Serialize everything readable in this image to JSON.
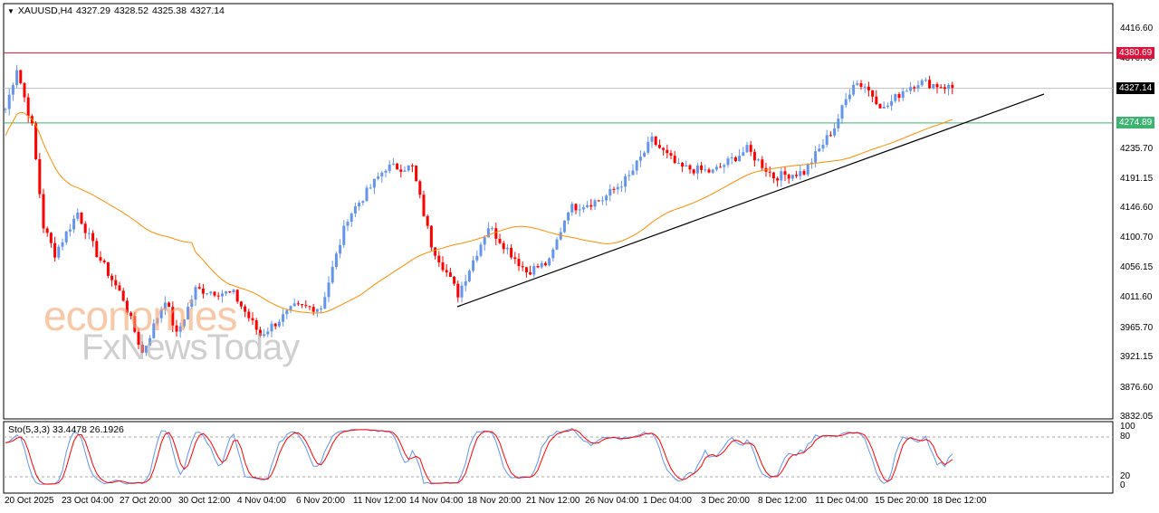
{
  "header": {
    "symbol": "XAUUSD,H4",
    "open": "4327.29",
    "high": "4328.52",
    "low": "4325.38",
    "close": "4327.14"
  },
  "price_axis": [
    "4416.60",
    "4370.70",
    "4235.70",
    "4191.15",
    "4146.60",
    "4100.70",
    "4056.15",
    "4011.60",
    "3965.70",
    "3921.15",
    "3876.60",
    "3832.05"
  ],
  "tags": {
    "resistance": "4380.69",
    "current": "4327.14",
    "support": "4274.89"
  },
  "stochastic": {
    "label": "Sto(5,3,3)",
    "main": "33.4478",
    "signal": "26.1926",
    "levels": [
      "100",
      "80",
      "20",
      "0"
    ]
  },
  "time_axis": [
    "20 Oct 2025",
    "23 Oct 04:00",
    "27 Oct 20:00",
    "30 Oct 12:00",
    "4 Nov 04:00",
    "6 Nov 20:00",
    "11 Nov 12:00",
    "14 Nov 04:00",
    "18 Nov 20:00",
    "21 Nov 12:00",
    "26 Nov 04:00",
    "1 Dec 04:00",
    "3 Dec 20:00",
    "8 Dec 12:00",
    "11 Dec 04:00",
    "15 Dec 20:00",
    "18 Dec 12:00"
  ],
  "watermark": {
    "line1": "economies",
    "line2": "FxNewsToday"
  },
  "colors": {
    "bull": "#6495ed",
    "bear": "#ff0000",
    "ma": "#ff8c00",
    "resistance": "#dc143c",
    "support": "#3cb371"
  },
  "chart_data": {
    "type": "candlestick",
    "symbol": "XAUUSD",
    "timeframe": "H4",
    "bars": 250,
    "waypoints": [
      [
        0,
        4296
      ],
      [
        3,
        4358
      ],
      [
        7,
        4269
      ],
      [
        10,
        4119
      ],
      [
        13,
        4078
      ],
      [
        19,
        4140
      ],
      [
        24,
        4078
      ],
      [
        31,
        4010
      ],
      [
        36,
        3928
      ],
      [
        42,
        4010
      ],
      [
        45,
        3955
      ],
      [
        50,
        4024
      ],
      [
        60,
        4017
      ],
      [
        67,
        3955
      ],
      [
        76,
        3997
      ],
      [
        83,
        3997
      ],
      [
        90,
        4133
      ],
      [
        100,
        4208
      ],
      [
        107,
        4208
      ],
      [
        112,
        4092
      ],
      [
        119,
        4017
      ],
      [
        127,
        4119
      ],
      [
        137,
        4051
      ],
      [
        143,
        4065
      ],
      [
        148,
        4146
      ],
      [
        157,
        4160
      ],
      [
        164,
        4194
      ],
      [
        170,
        4249
      ],
      [
        177,
        4208
      ],
      [
        186,
        4201
      ],
      [
        195,
        4235
      ],
      [
        202,
        4194
      ],
      [
        210,
        4201
      ],
      [
        218,
        4269
      ],
      [
        223,
        4337
      ],
      [
        226,
        4331
      ],
      [
        231,
        4296
      ],
      [
        236,
        4324
      ],
      [
        240,
        4337
      ],
      [
        250,
        4327
      ]
    ],
    "horizontal_levels": [
      4380.69,
      4327.14,
      4274.89
    ],
    "trendline": [
      [
        4004,
        120
      ],
      [
        4325,
        274
      ]
    ],
    "ylim": [
      3832.05,
      4430
    ]
  }
}
